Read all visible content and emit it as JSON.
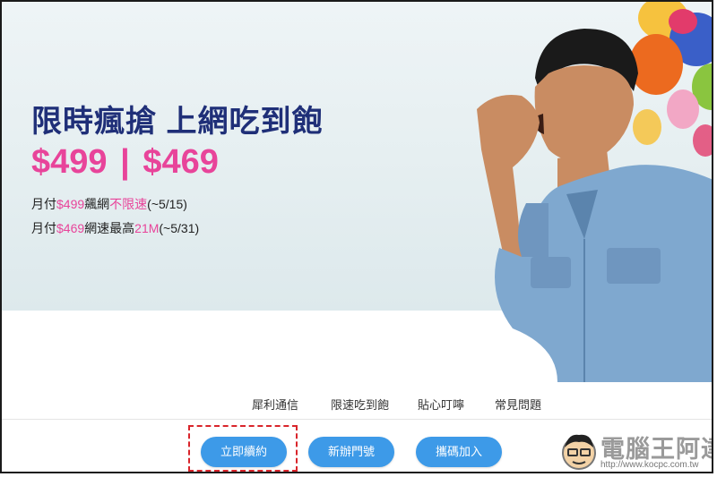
{
  "hero": {
    "headline": "限時瘋搶 上網吃到飽",
    "price_1": "$499",
    "price_sep": "|",
    "price_2": "$469",
    "line1": {
      "a": "月付",
      "b": "$499",
      "c": "飆網",
      "d": "不限速",
      "e": "(~5/15)"
    },
    "line2": {
      "a": "月付",
      "b": "$469",
      "c": "網速最高",
      "d": "21M",
      "e": "(~5/31)"
    }
  },
  "nav": {
    "items": [
      "犀利通信",
      "限速吃到飽",
      "貼心叮嚀",
      "常見問題"
    ]
  },
  "actions": {
    "renew": "立即續約",
    "new_number": "新辦門號",
    "port_in": "攜碼加入"
  },
  "watermark": {
    "text": "電腦王阿達",
    "url": "http://www.kocpc.com.tw"
  },
  "colors": {
    "brand_navy": "#1f2f78",
    "accent_pink": "#e8449a",
    "button_blue": "#3d9ae8",
    "highlight_red": "#d9252b"
  }
}
